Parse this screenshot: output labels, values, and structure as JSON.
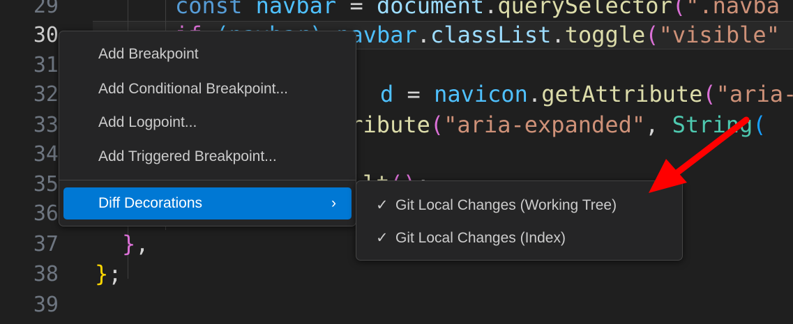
{
  "editor": {
    "line_numbers": [
      "29",
      "30",
      "31",
      "32",
      "33",
      "34",
      "35",
      "36",
      "37",
      "38",
      "39"
    ],
    "active_line": "30",
    "lines": {
      "l29": [
        "const",
        "navbar",
        "=",
        "document",
        ".",
        "querySelector",
        "(",
        "\".navba"
      ],
      "l30": [
        "if",
        "(navbar)",
        "navbar",
        ".",
        "classList",
        ".",
        "toggle",
        "(",
        "\"visible\""
      ],
      "l32": [
        "d",
        "=",
        "navicon",
        ".",
        "getAttribute",
        "(",
        "\"aria-ex"
      ],
      "l33": [
        "tribute",
        "(",
        "\"aria-expanded\"",
        ",",
        "String",
        "("
      ],
      "l35": [
        "lt",
        "()",
        ";"
      ],
      "l37": [
        "}",
        ","
      ],
      "l38": [
        "}",
        ";"
      ]
    }
  },
  "context_menu": {
    "items": [
      {
        "label": "Add Breakpoint"
      },
      {
        "label": "Add Conditional Breakpoint..."
      },
      {
        "label": "Add Logpoint..."
      },
      {
        "label": "Add Triggered Breakpoint..."
      },
      {
        "label": "Diff Decorations",
        "submenu_icon": "chevron-right-icon",
        "selected": true
      }
    ]
  },
  "submenu": {
    "items": [
      {
        "label": "Git Local Changes (Working Tree)",
        "checked": true,
        "icon": "check-icon"
      },
      {
        "label": "Git Local Changes (Index)",
        "checked": true,
        "icon": "check-icon"
      }
    ]
  },
  "annotation": {
    "arrow_color": "#ff0000",
    "icon": "red-arrow-icon"
  },
  "colors": {
    "accent": "#0078d4",
    "background": "#1f1f1f"
  }
}
